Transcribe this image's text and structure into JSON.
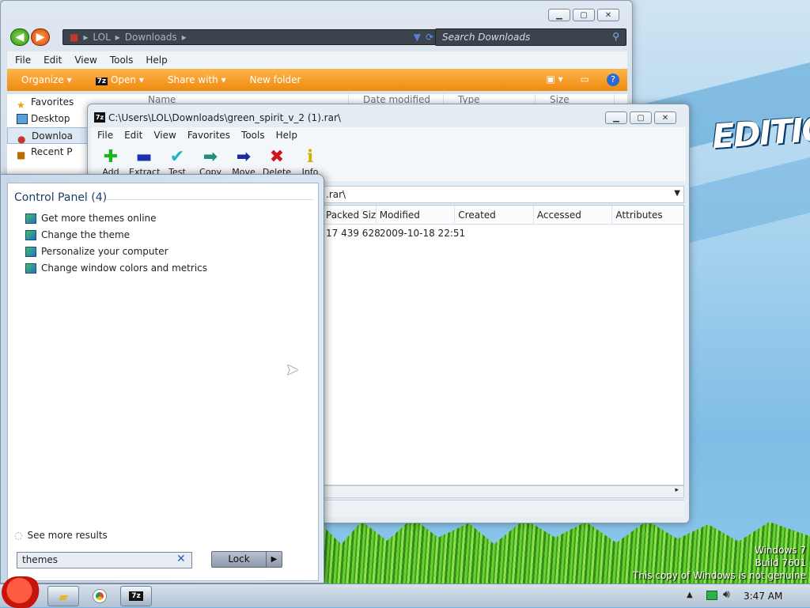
{
  "explorer": {
    "breadcrumb": [
      "LOL",
      "Downloads"
    ],
    "search_placeholder": "Search Downloads",
    "menu": [
      "File",
      "Edit",
      "View",
      "Tools",
      "Help"
    ],
    "toolbar": {
      "organize": "Organize",
      "open": "Open",
      "share": "Share with",
      "new_folder": "New folder"
    },
    "nav": [
      {
        "label": "Favorites",
        "icon": "star-icon"
      },
      {
        "label": "Desktop",
        "icon": "desktop-icon"
      },
      {
        "label": "Downloa",
        "icon": "downloads-icon"
      },
      {
        "label": "Recent P",
        "icon": "recent-places-icon"
      }
    ],
    "columns": [
      "Name",
      "Date modified",
      "Type",
      "Size"
    ]
  },
  "sevenzip": {
    "title": "C:\\Users\\LOL\\Downloads\\green_spirit_v_2 (1).rar\\",
    "menu": [
      "File",
      "Edit",
      "View",
      "Favorites",
      "Tools",
      "Help"
    ],
    "tools": [
      {
        "label": "Add",
        "icon": "plus-icon",
        "glyph": "✚",
        "color": "#19b41a"
      },
      {
        "label": "Extract",
        "icon": "minus-icon",
        "glyph": "▬",
        "color": "#1c2fb0"
      },
      {
        "label": "Test",
        "icon": "checkmark-icon",
        "glyph": "✔",
        "color": "#1cb6c8"
      },
      {
        "label": "Copy",
        "icon": "copy-arrow-icon",
        "glyph": "➡",
        "color": "#1d8f7a"
      },
      {
        "label": "Move",
        "icon": "move-arrow-icon",
        "glyph": "➡",
        "color": "#1b2d9a"
      },
      {
        "label": "Delete",
        "icon": "delete-x-icon",
        "glyph": "✖",
        "color": "#d0141a"
      },
      {
        "label": "Info",
        "icon": "info-icon",
        "glyph": "ℹ",
        "color": "#c7b300"
      }
    ],
    "path": ".rar\\",
    "columns": [
      "Packed Size",
      "Modified",
      "Created",
      "Accessed",
      "Attributes"
    ],
    "row": {
      "packed_size": "17 439 628",
      "modified": "2009-10-18 22:51",
      "created": "",
      "accessed": "",
      "attributes": ""
    }
  },
  "start_menu": {
    "group_title": "Control Panel (4)",
    "results": [
      "Get more themes online",
      "Change the theme",
      "Personalize your computer",
      "Change window colors and metrics"
    ],
    "see_more": "See more results",
    "search_value": "themes",
    "lock_label": "Lock"
  },
  "desktop": {
    "edition_text": "EDITION",
    "watermark": [
      "Windows 7",
      "Build 7601",
      "This copy of Windows is not genuine"
    ]
  },
  "taskbar": {
    "clock": "3:47 AM",
    "apps": [
      "explorer-folder-icon",
      "chrome-icon",
      "7zip-icon"
    ]
  },
  "colors": {
    "toolbar_orange": "#f09418",
    "accent_blue": "#1f5fc4"
  }
}
